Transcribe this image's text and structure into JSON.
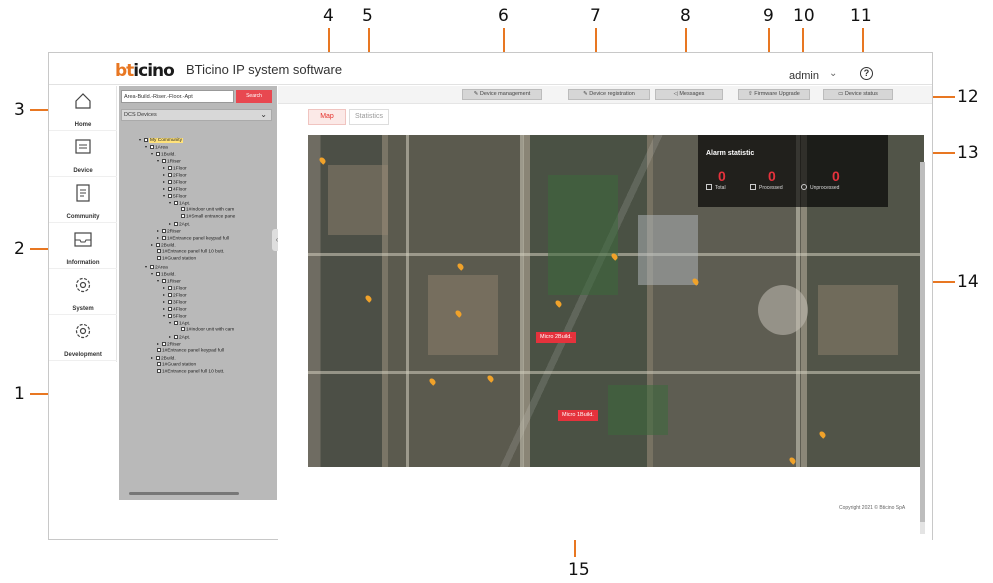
{
  "app": {
    "brand": "bticino",
    "title": "BTicino IP system software",
    "user": "admin",
    "help": "?"
  },
  "nav": [
    {
      "label": "Home",
      "icon": "home-icon"
    },
    {
      "label": "Device",
      "icon": "monitor-icon"
    },
    {
      "label": "Community",
      "icon": "document-icon"
    },
    {
      "label": "Information",
      "icon": "inbox-icon"
    },
    {
      "label": "System",
      "icon": "gear-icon"
    },
    {
      "label": "Development",
      "icon": "gear-icon"
    }
  ],
  "sidebar": {
    "search_placeholder": "Area-Build.-Riser.-Floor.-Apt",
    "search_button": "Search",
    "device_select": "DCS Devices",
    "tree": [
      {
        "text": "My Community",
        "highlight": true
      },
      {
        "text": "1Area"
      },
      {
        "text": "1Build."
      },
      {
        "text": "1Riser"
      },
      {
        "text": "1Floor"
      },
      {
        "text": "2Floor"
      },
      {
        "text": "3Floor"
      },
      {
        "text": "4Floor"
      },
      {
        "text": "5Floor"
      },
      {
        "text": "1Apt."
      },
      {
        "text": "1#Indoor unit with cam"
      },
      {
        "text": "1#Small entrance pane"
      },
      {
        "text": "2Apt."
      },
      {
        "text": "2Riser"
      },
      {
        "text": "1#Entrance panel keypad full"
      },
      {
        "text": "2Build."
      },
      {
        "text": "1#Entrance panel full 10 butt."
      },
      {
        "text": "1#Guard station"
      },
      {
        "text": "2Area"
      },
      {
        "text": "1Build."
      },
      {
        "text": "1Riser"
      },
      {
        "text": "1Floor"
      },
      {
        "text": "2Floor"
      },
      {
        "text": "3Floor"
      },
      {
        "text": "4Floor"
      },
      {
        "text": "5Floor"
      },
      {
        "text": "1Apt."
      },
      {
        "text": "1#Indoor unit with cam"
      },
      {
        "text": "2Apt."
      },
      {
        "text": "2Riser"
      },
      {
        "text": "1#Entrance panel keypad full"
      },
      {
        "text": "2Build."
      },
      {
        "text": "1#Guard station"
      },
      {
        "text": "1#Entrance panel full 10 butt."
      }
    ]
  },
  "toolbar": {
    "device_management": "Device management",
    "device_registration": "Device registration",
    "messages": "Messages",
    "firmware_upgrade": "Firmware Upgrade",
    "device_status": "Device status"
  },
  "tabs": {
    "map": "Map",
    "statistics": "Statistics"
  },
  "alarm": {
    "title": "Alarm statistic",
    "counts": [
      {
        "value": "0",
        "label": "Total"
      },
      {
        "value": "0",
        "label": "Processed"
      },
      {
        "value": "0",
        "label": "Unprocessed"
      }
    ]
  },
  "map_labels": [
    "Micro 2Build.",
    "Micro 1Build."
  ],
  "footer": {
    "copyright": "Copyright 2021 © Bticino SpA"
  },
  "callouts": [
    "1",
    "2",
    "3",
    "4",
    "5",
    "6",
    "7",
    "8",
    "9",
    "10",
    "11",
    "12",
    "13",
    "14",
    "15"
  ],
  "colors": {
    "accent": "#e87722",
    "brand_red": "#e5322d",
    "alarm_red": "#e5323c"
  }
}
